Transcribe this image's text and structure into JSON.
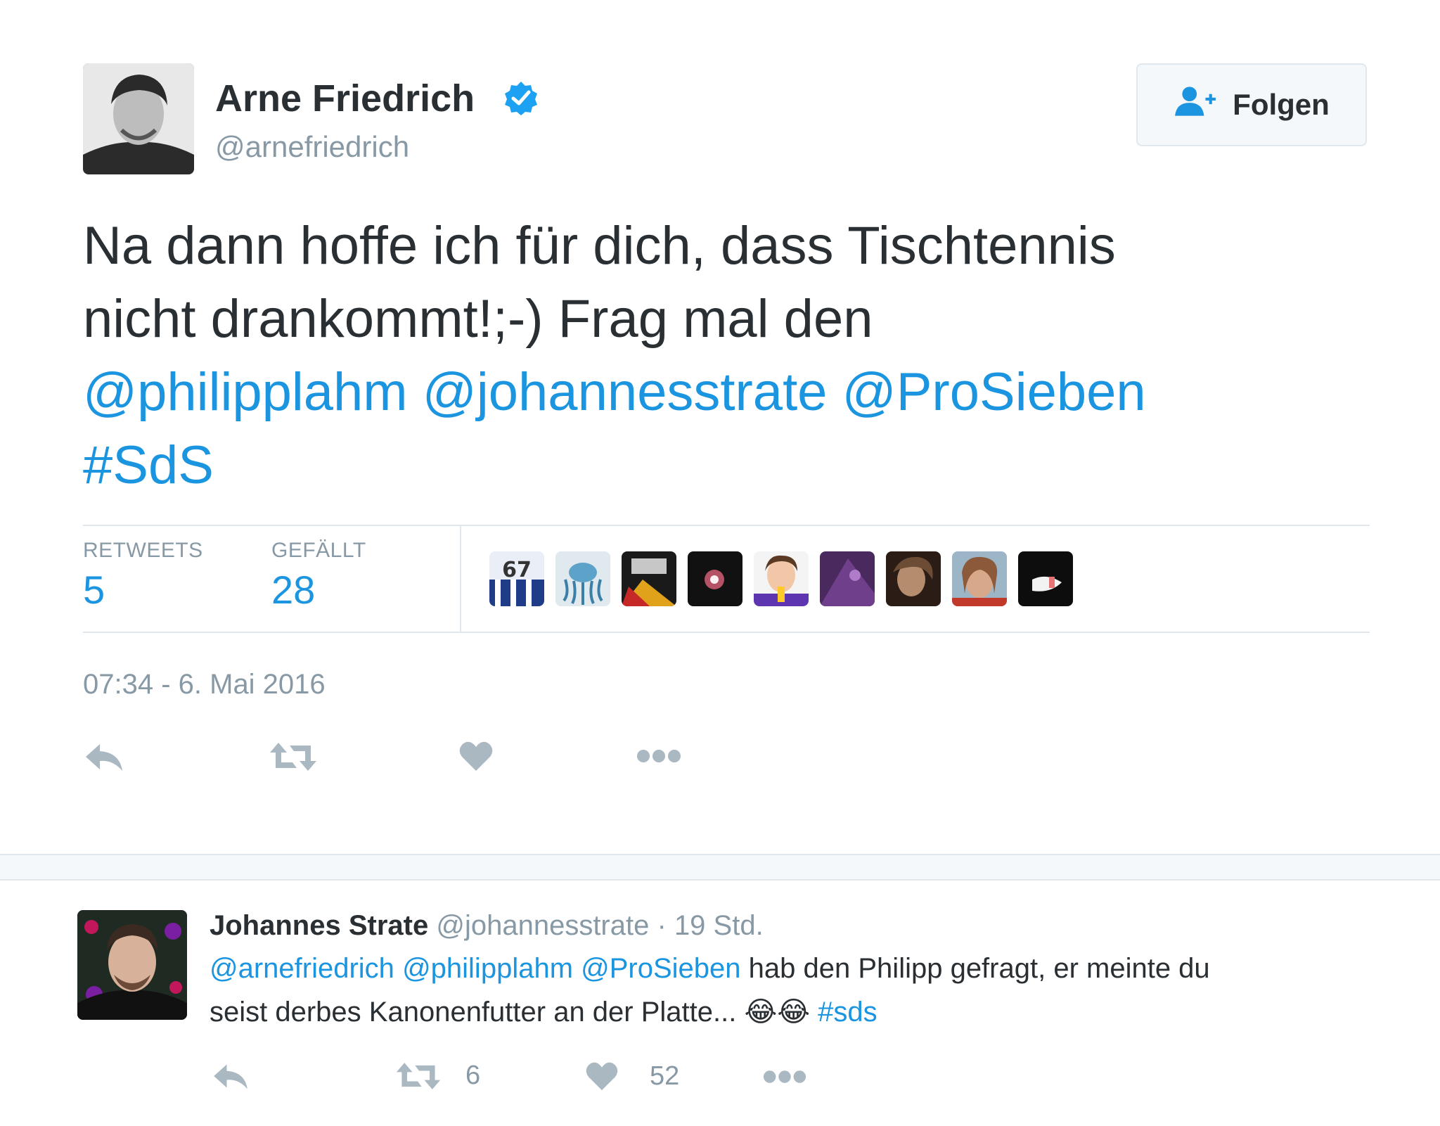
{
  "main_tweet": {
    "author_name": "Arne Friedrich",
    "author_handle": "@arnefriedrich",
    "verified": true,
    "follow_label": "Folgen",
    "text_line1": "Na dann hoffe ich für dich, dass Tischtennis",
    "text_line2": "nicht drankommt!;-) Frag mal den",
    "mentions": [
      "@philipplahm",
      "@johannesstrate",
      "@ProSieben"
    ],
    "hashtag": "#SdS",
    "retweets_label": "RETWEETS",
    "retweets_count": "5",
    "likes_label": "GEFÄLLT",
    "likes_count": "28",
    "timestamp": "07:34 - 6. Mai 2016",
    "liker_avatars": [
      "liker-1",
      "liker-2",
      "liker-3",
      "liker-4",
      "liker-5",
      "liker-6",
      "liker-7",
      "liker-8",
      "liker-9"
    ],
    "liker_first_jersey_text": "67"
  },
  "reply": {
    "author_name": "Johannes Strate",
    "author_handle": "@johannesstrate",
    "time_sep": "·",
    "time": "19 Std.",
    "mentions": [
      "@arnefriedrich",
      "@philipplahm",
      "@ProSieben"
    ],
    "text_part1": "hab den Philipp gefragt, er meinte du",
    "text_part2": "seist derbes Kanonenfutter an der Platte...",
    "emoji": "😂😂",
    "hashtag": "#sds",
    "retweet_count": "6",
    "like_count": "52"
  },
  "icons": {
    "reply": "reply-icon",
    "retweet": "retweet-icon",
    "like": "heart-icon",
    "more": "more-icon",
    "verified": "verified-badge-icon",
    "follow": "follow-person-icon"
  },
  "colors": {
    "link": "#1b95e0",
    "muted": "#8899a6",
    "text": "#292f33",
    "icon": "#aab8c2",
    "divider": "#e1e8ed"
  }
}
